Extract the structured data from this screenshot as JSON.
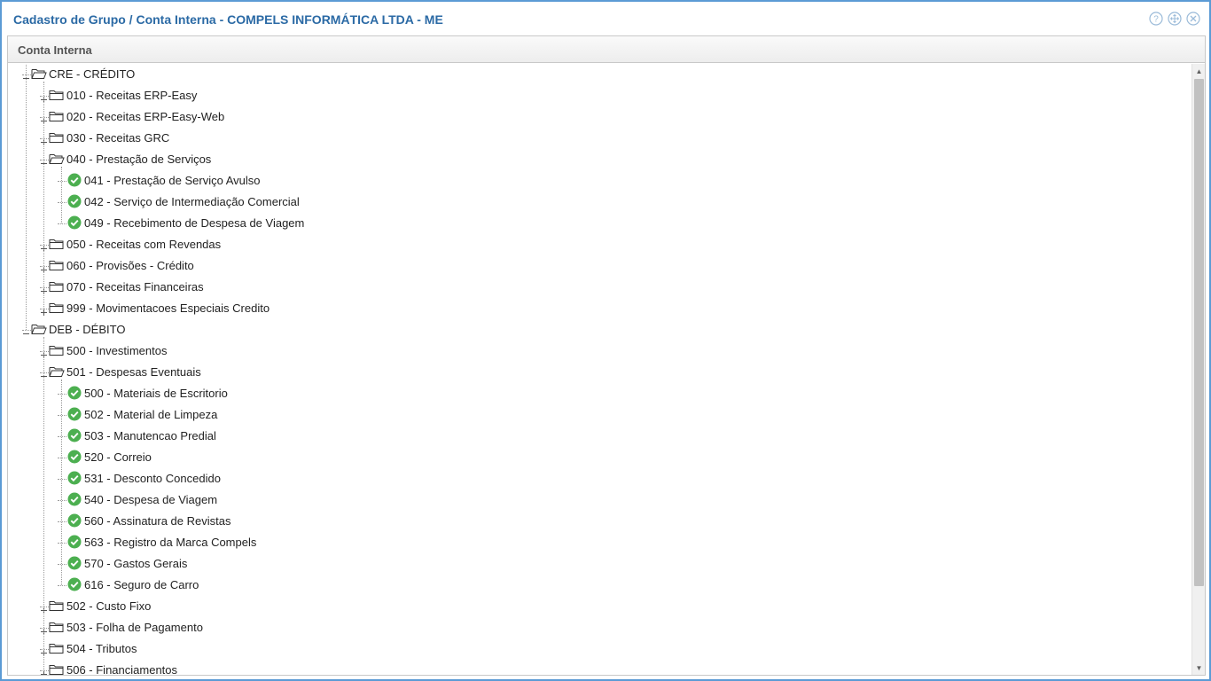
{
  "window": {
    "title": "Cadastro de Grupo / Conta Interna - COMPELS INFORMÁTICA LTDA - ME",
    "buttons": [
      {
        "name": "help-icon"
      },
      {
        "name": "maximize-icon"
      },
      {
        "name": "close-icon"
      }
    ]
  },
  "panel": {
    "header": "Conta Interna"
  },
  "tree": {
    "rows": [
      {
        "level": 0,
        "type": "folder-open",
        "label": "CRE - CRÉDITO"
      },
      {
        "level": 1,
        "type": "folder",
        "label": "010 - Receitas ERP-Easy"
      },
      {
        "level": 1,
        "type": "folder",
        "label": "020 - Receitas ERP-Easy-Web"
      },
      {
        "level": 1,
        "type": "folder",
        "label": "030 - Receitas GRC"
      },
      {
        "level": 1,
        "type": "folder-open",
        "label": "040 - Prestação de Serviços"
      },
      {
        "level": 2,
        "type": "leaf",
        "label": "041 - Prestação de Serviço Avulso"
      },
      {
        "level": 2,
        "type": "leaf",
        "label": "042 - Serviço de Intermediação Comercial"
      },
      {
        "level": 2,
        "type": "leaf",
        "label": "049 - Recebimento de Despesa de Viagem"
      },
      {
        "level": 1,
        "type": "folder",
        "label": "050 - Receitas com Revendas"
      },
      {
        "level": 1,
        "type": "folder",
        "label": "060 - Provisões - Crédito"
      },
      {
        "level": 1,
        "type": "folder",
        "label": "070 - Receitas Financeiras"
      },
      {
        "level": 1,
        "type": "folder",
        "label": "999 - Movimentacoes Especiais Credito"
      },
      {
        "level": 0,
        "type": "folder-open",
        "label": "DEB - DÉBITO"
      },
      {
        "level": 1,
        "type": "folder",
        "label": "500 - Investimentos"
      },
      {
        "level": 1,
        "type": "folder-open",
        "label": "501 - Despesas Eventuais"
      },
      {
        "level": 2,
        "type": "leaf",
        "label": "500 - Materiais de Escritorio"
      },
      {
        "level": 2,
        "type": "leaf",
        "label": "502 - Material de Limpeza"
      },
      {
        "level": 2,
        "type": "leaf",
        "label": "503 - Manutencao Predial"
      },
      {
        "level": 2,
        "type": "leaf",
        "label": "520 - Correio"
      },
      {
        "level": 2,
        "type": "leaf",
        "label": "531 - Desconto Concedido"
      },
      {
        "level": 2,
        "type": "leaf",
        "label": "540 - Despesa de Viagem"
      },
      {
        "level": 2,
        "type": "leaf",
        "label": "560 - Assinatura de Revistas"
      },
      {
        "level": 2,
        "type": "leaf",
        "label": "563 - Registro da Marca Compels"
      },
      {
        "level": 2,
        "type": "leaf",
        "label": "570 - Gastos Gerais"
      },
      {
        "level": 2,
        "type": "leaf",
        "label": "616 - Seguro de Carro"
      },
      {
        "level": 1,
        "type": "folder",
        "label": "502 - Custo Fixo"
      },
      {
        "level": 1,
        "type": "folder",
        "label": "503 - Folha de Pagamento"
      },
      {
        "level": 1,
        "type": "folder",
        "label": "504 - Tributos"
      },
      {
        "level": 1,
        "type": "folder",
        "label": "506 - Financiamentos"
      }
    ]
  },
  "colors": {
    "title": "#2b6aa5",
    "window_border": "#5b9bd5",
    "leaf_check": "#4caf50"
  }
}
